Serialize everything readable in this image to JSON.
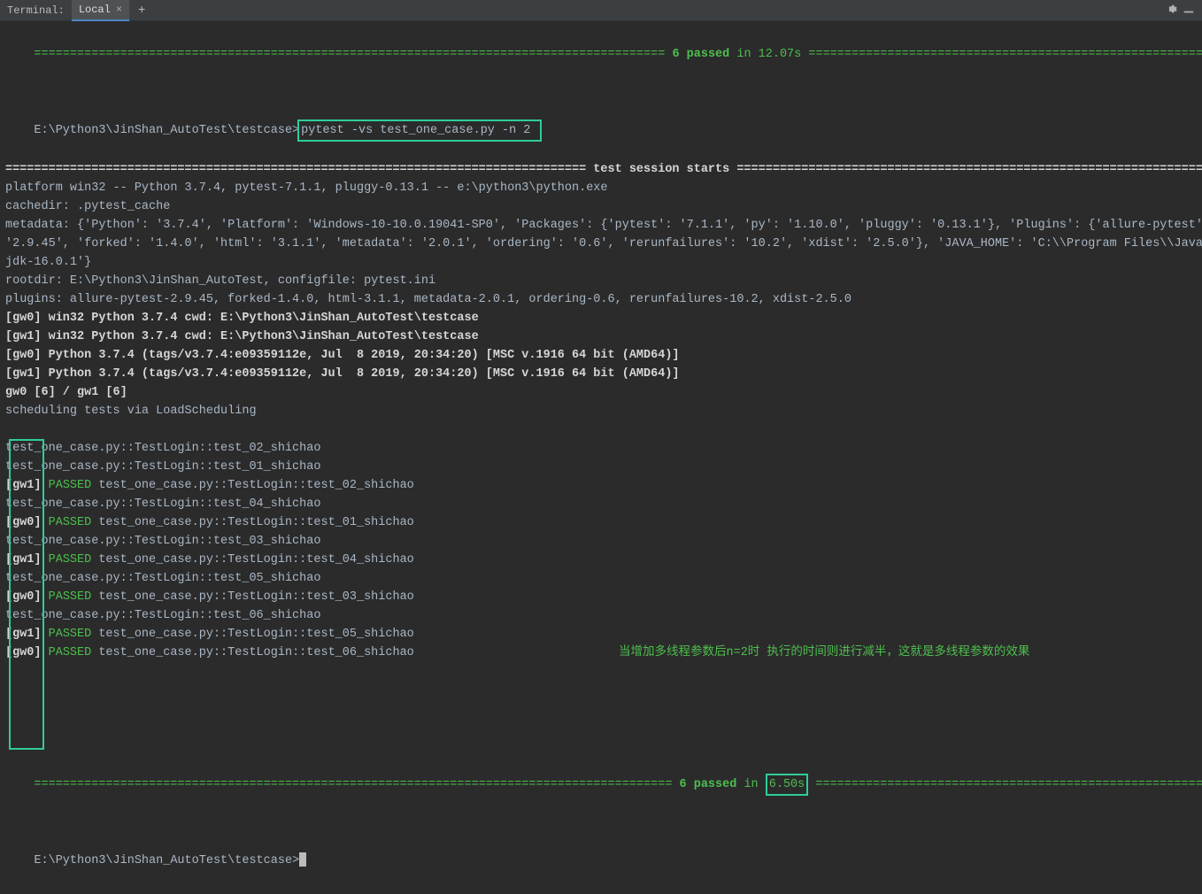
{
  "header": {
    "terminal_label": "Terminal:",
    "tab_label": "Local",
    "tab_close": "×",
    "tab_add": "+",
    "gear": "settings",
    "hide": "hide"
  },
  "top_banner": {
    "pre": "======================================================================================== ",
    "passed": "6 passed",
    "in": " in ",
    "time": "12.07s",
    "post": " ========================================================================================"
  },
  "prompt1": "E:\\Python3\\JinShan_AutoTest\\testcase>",
  "command": "pytest -vs test_one_case.py -n 2 ",
  "session_header": "================================================================================= test session starts ==================================================================================",
  "platform_line": "platform win32 -- Python 3.7.4, pytest-7.1.1, pluggy-0.13.1 -- e:\\python3\\python.exe",
  "cachedir_line": "cachedir: .pytest_cache",
  "metadata_line1": "metadata: {'Python': '3.7.4', 'Platform': 'Windows-10-10.0.19041-SP0', 'Packages': {'pytest': '7.1.1', 'py': '1.10.0', 'pluggy': '0.13.1'}, 'Plugins': {'allure-pytest': ",
  "metadata_line2": "'2.9.45', 'forked': '1.4.0', 'html': '3.1.1', 'metadata': '2.0.1', 'ordering': '0.6', 'rerunfailures': '10.2', 'xdist': '2.5.0'}, 'JAVA_HOME': 'C:\\\\Program Files\\\\Java\\\\",
  "metadata_line3": "jdk-16.0.1'}",
  "rootdir_line": "rootdir: E:\\Python3\\JinShan_AutoTest, configfile: pytest.ini",
  "plugins_line": "plugins: allure-pytest-2.9.45, forked-1.4.0, html-3.1.1, metadata-2.0.1, ordering-0.6, rerunfailures-10.2, xdist-2.5.0",
  "gw0_cwd": "[gw0] win32 Python 3.7.4 cwd: E:\\Python3\\JinShan_AutoTest\\testcase",
  "gw1_cwd": "[gw1] win32 Python 3.7.4 cwd: E:\\Python3\\JinShan_AutoTest\\testcase",
  "gw0_py": "[gw0] Python 3.7.4 (tags/v3.7.4:e09359112e, Jul  8 2019, 20:34:20) [MSC v.1916 64 bit (AMD64)]",
  "gw1_py": "[gw1] Python 3.7.4 (tags/v3.7.4:e09359112e, Jul  8 2019, 20:34:20) [MSC v.1916 64 bit (AMD64)]",
  "gw_counts": "gw0 [6] / gw1 [6]",
  "scheduling": "scheduling tests via LoadScheduling",
  "results": [
    {
      "type": "plain",
      "text": "test_one_case.py::TestLogin::test_02_shichao "
    },
    {
      "type": "plain",
      "text": "test_one_case.py::TestLogin::test_01_shichao "
    },
    {
      "type": "pass",
      "gw": "[gw1]",
      "passed": " PASSED ",
      "tail": "test_one_case.py::TestLogin::test_02_shichao "
    },
    {
      "type": "plain",
      "text": "test_one_case.py::TestLogin::test_04_shichao "
    },
    {
      "type": "pass",
      "gw": "[gw0]",
      "passed": " PASSED ",
      "tail": "test_one_case.py::TestLogin::test_01_shichao "
    },
    {
      "type": "plain",
      "text": "test_one_case.py::TestLogin::test_03_shichao "
    },
    {
      "type": "pass",
      "gw": "[gw1]",
      "passed": " PASSED ",
      "tail": "test_one_case.py::TestLogin::test_04_shichao "
    },
    {
      "type": "plain",
      "text": "test_one_case.py::TestLogin::test_05_shichao "
    },
    {
      "type": "pass",
      "gw": "[gw0]",
      "passed": " PASSED ",
      "tail": "test_one_case.py::TestLogin::test_03_shichao "
    },
    {
      "type": "plain",
      "text": "test_one_case.py::TestLogin::test_06_shichao "
    },
    {
      "type": "pass",
      "gw": "[gw1]",
      "passed": " PASSED ",
      "tail": "test_one_case.py::TestLogin::test_05_shichao "
    },
    {
      "type": "pass",
      "gw": "[gw0]",
      "passed": " PASSED ",
      "tail": "test_one_case.py::TestLogin::test_06_shichao "
    }
  ],
  "annotation": "当增加多线程参数后n=2时 执行的时间则进行减半，这就是多线程参数的效果",
  "bottom_banner": {
    "pre": "========================================================================================= ",
    "passed": "6 passed",
    "in": " in ",
    "time": "6.50s",
    "post": " ========================================================================================="
  },
  "prompt2": "E:\\Python3\\JinShan_AutoTest\\testcase>"
}
